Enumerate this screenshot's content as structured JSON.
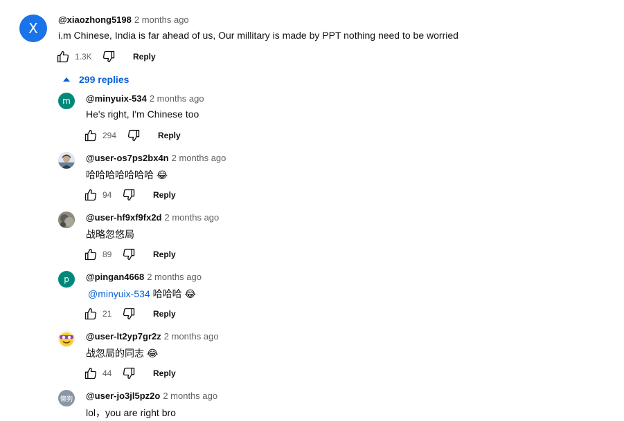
{
  "top_comment": {
    "avatar_letter": "X",
    "avatar_color": "#1a73e8",
    "handle": "@xiaozhong5198",
    "time": "2 months ago",
    "text": "i.m Chinese, India is far ahead of us, Our millitary is made by PPT nothing need to be worried",
    "likes": "1.3K",
    "reply_label": "Reply"
  },
  "replies_toggle": {
    "label": "299 replies",
    "icon": "caret-up-icon"
  },
  "replies": [
    {
      "handle": "@minyuix-534",
      "time": "2 months ago",
      "text": "He's right, I'm Chinese too",
      "likes": "294",
      "reply_label": "Reply",
      "avatar_letter": "m",
      "avatar_color": "#00897b"
    },
    {
      "handle": "@user-os7ps2bx4n",
      "time": "2 months ago",
      "text": "哈哈哈哈哈哈哈 😂",
      "likes": "94",
      "reply_label": "Reply",
      "avatar_kind": "photo"
    },
    {
      "handle": "@user-hf9xf9fx2d",
      "time": "2 months ago",
      "text": "战略忽悠局",
      "likes": "89",
      "reply_label": "Reply",
      "avatar_kind": "photo"
    },
    {
      "handle": "@pingan4668",
      "time": "2 months ago",
      "mention": "@minyuix-534",
      "text": " 哈哈哈 😂",
      "likes": "21",
      "reply_label": "Reply",
      "avatar_letter": "p",
      "avatar_color": "#00897b"
    },
    {
      "handle": "@user-lt2yp7gr2z",
      "time": "2 months ago",
      "text": "战忽局的同志 😂",
      "likes": "44",
      "reply_label": "Reply",
      "avatar_kind": "cartoon"
    },
    {
      "handle": "@user-jo3jl5pz2o",
      "time": "2 months ago",
      "text": "lol，you are right bro",
      "avatar_text": "懒狗",
      "avatar_color": "#8a96a3"
    }
  ],
  "colors": {
    "link": "#065fd4",
    "secondary_text": "#606060",
    "text": "#0f0f0f"
  }
}
